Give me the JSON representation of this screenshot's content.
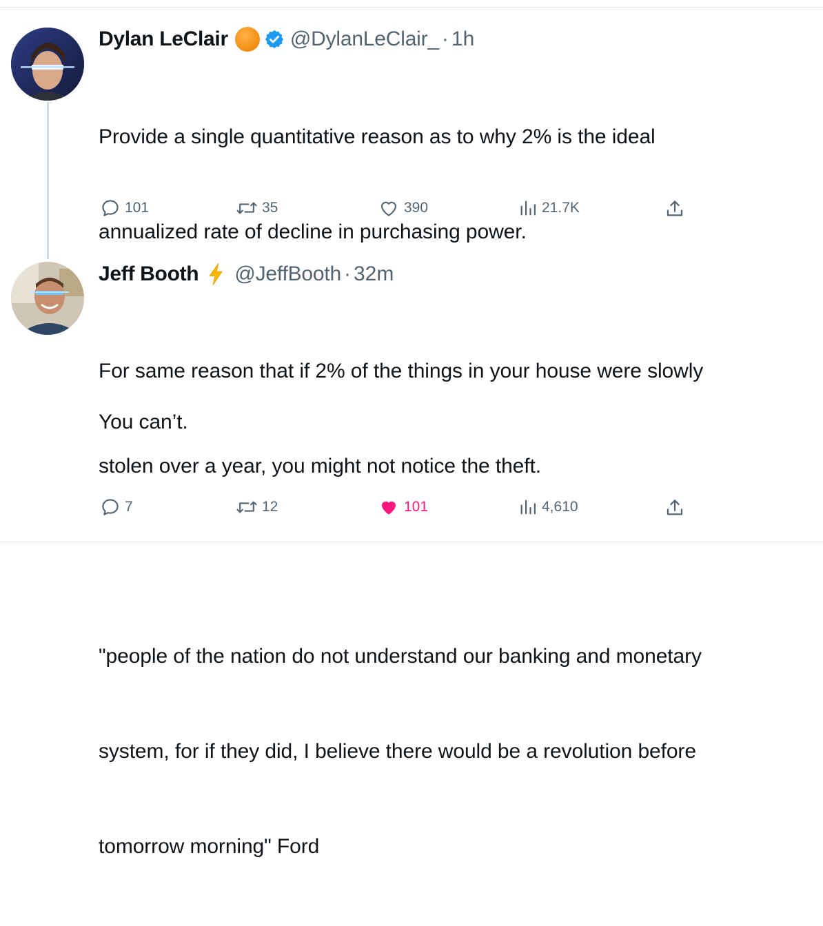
{
  "tweets": [
    {
      "author_name": "Dylan LeClair",
      "handle": "@DylanLeClair_",
      "separator": "·",
      "time": "1h",
      "lines": [
        "Provide a single quantitative reason as to why 2% is the ideal",
        "annualized rate of decline in purchasing power.",
        "",
        "You can’t."
      ],
      "replies": "101",
      "reposts": "35",
      "likes": "390",
      "views": "21.7K",
      "badges": [
        "orange-circle-icon",
        "verified-badge-icon"
      ]
    },
    {
      "author_name": "Jeff Booth",
      "handle": "@JeffBooth",
      "separator": "·",
      "time": "32m",
      "lines": [
        "For same reason that if 2% of the things in your house were slowly",
        "stolen over a year, you might not notice the theft.",
        "",
        "\"people of the nation do not understand our banking and monetary",
        "system, for if they did, I believe there would be a revolution before",
        "tomorrow morning\" Ford"
      ],
      "replies": "7",
      "reposts": "12",
      "likes": "101",
      "views": "4,610",
      "liked": true,
      "badges": [
        "lightning-icon"
      ]
    }
  ],
  "colors": {
    "text": "#0f1419",
    "secondary": "#536471",
    "verified": "#1d9bf0",
    "like_active": "#f91880",
    "bitcoin_orange": "#f7931a",
    "lightning": "#f5b800"
  }
}
